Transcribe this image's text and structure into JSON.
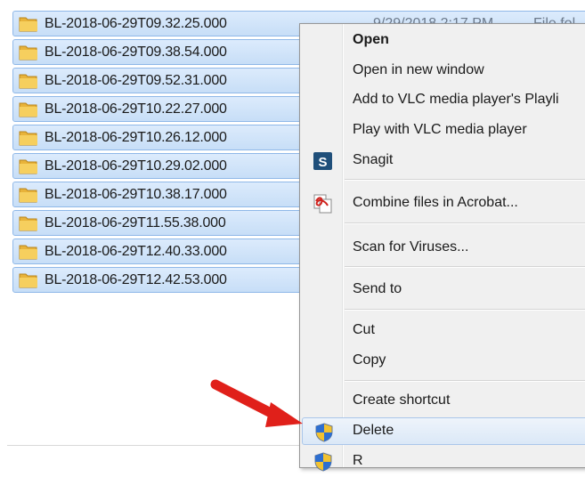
{
  "files": [
    {
      "name": "BL-2018-06-29T09.32.25.000",
      "date": "9/29/2018 2:17 PM",
      "type": "File fol"
    },
    {
      "name": "BL-2018-06-29T09.38.54.000"
    },
    {
      "name": "BL-2018-06-29T09.52.31.000"
    },
    {
      "name": "BL-2018-06-29T10.22.27.000"
    },
    {
      "name": "BL-2018-06-29T10.26.12.000"
    },
    {
      "name": "BL-2018-06-29T10.29.02.000"
    },
    {
      "name": "BL-2018-06-29T10.38.17.000"
    },
    {
      "name": "BL-2018-06-29T11.55.38.000"
    },
    {
      "name": "BL-2018-06-29T12.40.33.000"
    },
    {
      "name": "BL-2018-06-29T12.42.53.000"
    }
  ],
  "context_menu": {
    "open": "Open",
    "open_new_window": "Open in new window",
    "add_vlc_playlist": "Add to VLC media player's Playli",
    "play_vlc": "Play with VLC media player",
    "snagit": "Snagit",
    "combine_acrobat": "Combine files in Acrobat...",
    "scan_viruses": "Scan for Viruses...",
    "send_to": "Send to",
    "cut": "Cut",
    "copy": "Copy",
    "create_shortcut": "Create shortcut",
    "delete": "Delete",
    "rename_partial": "R"
  },
  "colors": {
    "selection": "#cce0f7",
    "menu_background": "#f0f0f0",
    "arrow": "#e0201a"
  }
}
